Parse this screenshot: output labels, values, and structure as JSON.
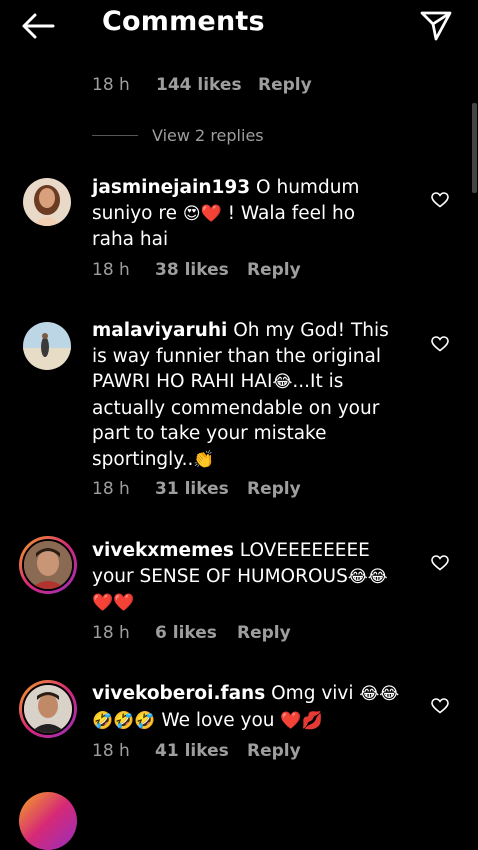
{
  "header": {
    "title": "Comments"
  },
  "top_meta": {
    "time": "18 h",
    "likes": "144 likes",
    "reply": "Reply"
  },
  "view_replies": "View 2 replies",
  "comments": [
    {
      "username": "jasminejain193",
      "text_parts": [
        "O humdum suniyo re ",
        "😍❤️",
        " ! Wala feel ho raha hai"
      ],
      "time": "18 h",
      "likes": "38 likes",
      "reply": "Reply"
    },
    {
      "username": "malaviyaruhi",
      "text_parts": [
        "Oh my God! This is way funnier than the original PAWRI HO RAHI HAI",
        "😂",
        "...It is actually commendable on your part to take your mistake sportingly..",
        "👏"
      ],
      "time": "18 h",
      "likes": "31 likes",
      "reply": "Reply"
    },
    {
      "username": "vivekxmemes",
      "text_parts": [
        "LOVEEEEEEEE your SENSE OF HUMOROUS",
        "😂😂",
        " ",
        "❤️❤️"
      ],
      "time": "18 h",
      "likes": "6 likes",
      "reply": "Reply"
    },
    {
      "username": "vivekoberoi.fans",
      "text_parts": [
        "Omg vivi ",
        "😂😂",
        " ",
        "🤣🤣🤣",
        " We love you ",
        "❤️💋"
      ],
      "time": "18 h",
      "likes": "41 likes",
      "reply": "Reply"
    }
  ],
  "colors": {
    "background": "#000000",
    "text": "#ffffff",
    "muted": "#9e9e9e",
    "story_ring": "#d62976"
  },
  "icons": {
    "back": "arrow-left-icon",
    "send": "paper-plane-icon",
    "like": "heart-outline-icon"
  }
}
